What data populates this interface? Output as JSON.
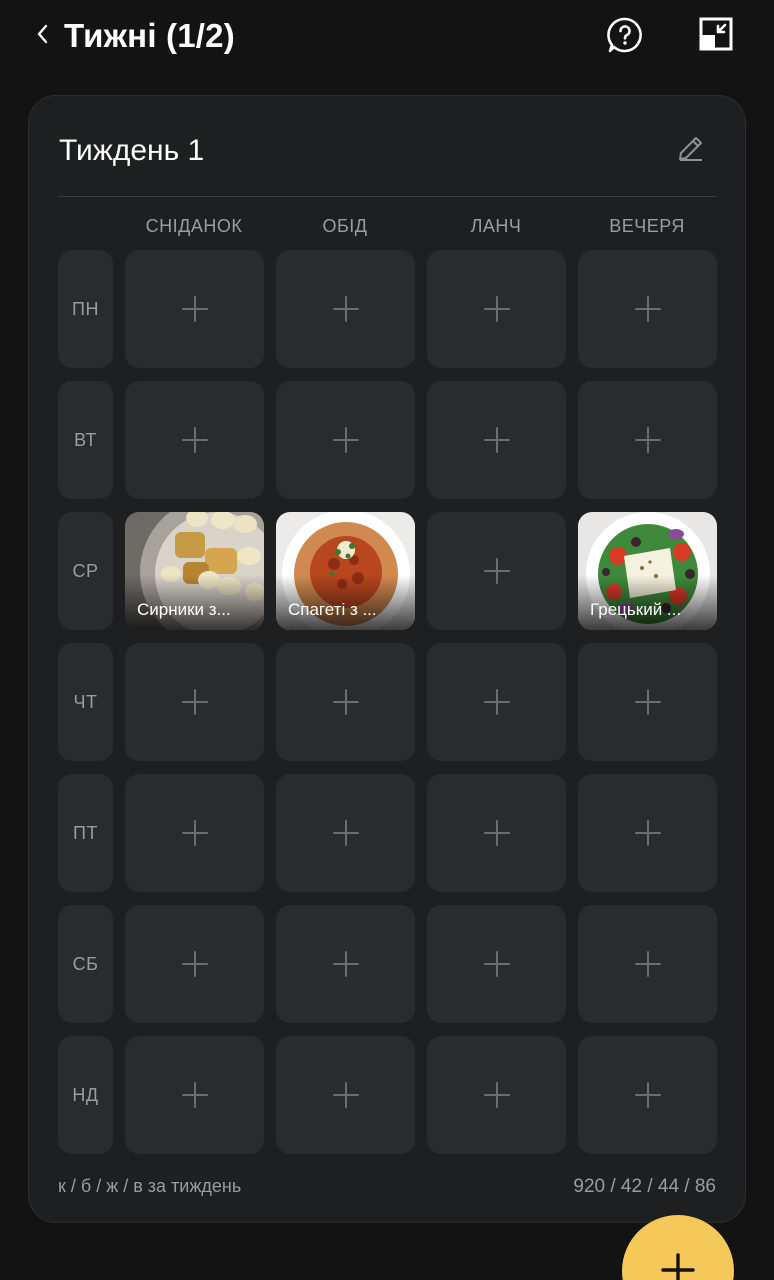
{
  "header": {
    "title": "Тижні (1/2)",
    "back_icon": "chevron-left-icon",
    "help_icon": "help-circle-icon",
    "collapse_icon": "collapse-window-icon"
  },
  "card": {
    "title": "Тиждень 1",
    "edit_icon": "pencil-icon",
    "columns": [
      "СНІДАНОК",
      "ОБІД",
      "ЛАНЧ",
      "ВЕЧЕРЯ"
    ],
    "days": [
      "ПН",
      "ВТ",
      "СР",
      "ЧТ",
      "ПТ",
      "СБ",
      "НД"
    ],
    "meals": {
      "wed_breakfast": "Сирники з...",
      "wed_lunch": "Спагеті з ...",
      "wed_dinner": "Грецький ..."
    },
    "footer": {
      "label": "к / б / ж / в за тиждень",
      "totals": "920 / 42 / 44 / 86"
    }
  },
  "fab": {
    "icon": "plus-icon"
  },
  "colors": {
    "background": "#131314",
    "card": "#1e1f21",
    "slot": "#2a2b2e",
    "accent": "#f5c85a",
    "muted_text": "#9a9ca1"
  }
}
